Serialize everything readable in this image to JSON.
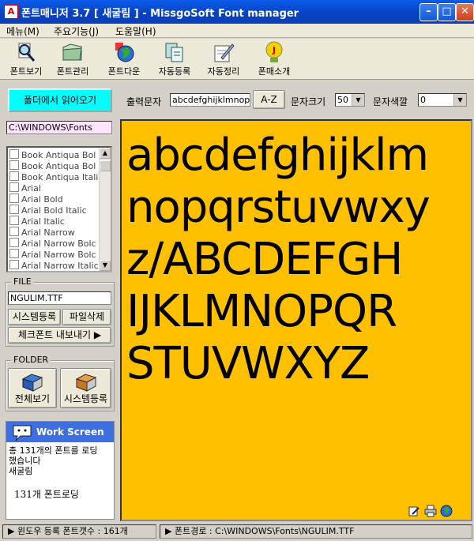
{
  "window": {
    "title": "폰트매니저 3.7 [ 새굴림 ] - MissgoSoft Font manager",
    "app_icon_letter": "A"
  },
  "menu": [
    "메뉴(M)",
    "주요기능(J)",
    "도움말(H)"
  ],
  "toolbar": [
    {
      "label": "폰트보기",
      "icon": "magnifier-icon"
    },
    {
      "label": "폰트관리",
      "icon": "folder-icon"
    },
    {
      "label": "폰트다운",
      "icon": "globe-icon"
    },
    {
      "label": "자동등록",
      "icon": "copy-icon"
    },
    {
      "label": "자동정리",
      "icon": "pen-icon"
    },
    {
      "label": "폰매소개",
      "icon": "mascot-icon"
    }
  ],
  "left": {
    "load_button": "폴더에서 읽어오기",
    "path": "C:\\WINDOWS\\Fonts",
    "fonts": [
      "Book Antiqua Bol",
      "Book Antiqua Bol",
      "Book Antiqua Itali",
      "Arial",
      "Arial Bold",
      "Arial Bold Italic",
      "Arial Italic",
      "Arial Narrow",
      "Arial Narrow Bolc",
      "Arial Narrow Bolc",
      "Arial Narrow Italic"
    ],
    "file_group": "FILE",
    "file_name": "NGULIM.TTF",
    "register_button": "시스템등록",
    "delete_button": "파일삭제",
    "export_button": "체크폰트 내보내기 ▶",
    "folder_group": "FOLDER",
    "view_all_button": "전체보기",
    "sys_register_button": "시스템등록",
    "work_screen": {
      "title": "Work Screen",
      "lines": [
        "총 131개의 폰트를 로딩",
        "했습니다",
        "새굴림"
      ],
      "loading": "131개  폰트로딩"
    }
  },
  "controls": {
    "output_label": "출력문자",
    "output_value": "abcdefghijklmnop",
    "az_button": "A-Z",
    "size_label": "문자크기",
    "size_value": "50",
    "color_label": "문자색깔",
    "color_value": "0"
  },
  "preview": {
    "lines": [
      "abcdefghijklm",
      "nopqrstuvwxy",
      "z/ABCDEFGH",
      "IJKLMNOPQR",
      "STUVWXYZ"
    ],
    "background": "#ffc000"
  },
  "status": {
    "left": "▶ 윈도우 등록 폰트갯수 : 161개",
    "right": "▶ 폰트경로 :  C:\\WINDOWS\\Fonts\\NGULIM.TTF"
  }
}
